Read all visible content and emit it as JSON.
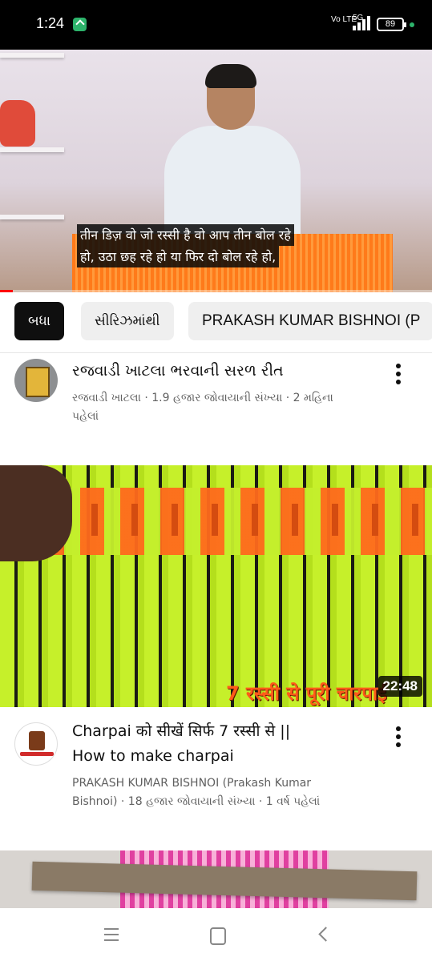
{
  "status_bar": {
    "time": "1:24",
    "network_label": "Vo LTE",
    "network_type": "5G",
    "battery": "89"
  },
  "player": {
    "subtitle_line_1": "तीन डिज़ वो जो रस्सी है वो आप तीन बोल रहे",
    "subtitle_line_2": "हो, उठा छह रहे हो या फिर दो बोल रहे हो,",
    "progress_fraction": 0.03
  },
  "chips": [
    {
      "label": "બધા",
      "selected": true
    },
    {
      "label": "સીરિઝમાંથી",
      "selected": false
    },
    {
      "label": "PRAKASH KUMAR BISHNOI (P",
      "selected": false
    }
  ],
  "current_video": {
    "title": "રજવાડી ખાટલા ભરવાની સરળ  રીત",
    "meta_line_1": "રજવાડી ખાટલા · 1.9 હજાર જોવાયાની સંખ્યા · 2 મહિના",
    "meta_line_2": "પહેલાં",
    "channel_avatar_icon": "channel-avatar-icon"
  },
  "recommended": [
    {
      "thumbnail_caption": "7 रस्सी से पूरी चारपाई",
      "duration": "22:48",
      "title_line_1": "Charpai को सीखें सिर्फ 7 रस्सी से ||",
      "title_line_2": "How to make charpai",
      "meta_line_1": "PRAKASH KUMAR BISHNOI (Prakash Kumar",
      "meta_line_2": "Bishnoi) · 18 હજાર જોવાયાની સંખ્યા · 1 વર્ષ પહેલાં"
    }
  ],
  "colors": {
    "accent_red": "#ff0000",
    "chip_selected_bg": "#0f0f0f",
    "chip_bg": "#efefef",
    "meta_text": "#606060"
  },
  "nav_icons": [
    "menu-icon",
    "home-icon",
    "back-icon"
  ]
}
